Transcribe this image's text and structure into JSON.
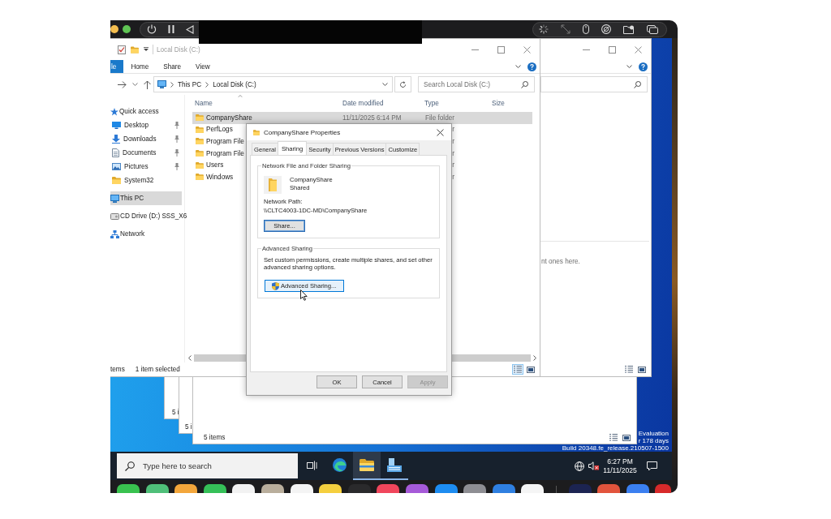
{
  "explorer": {
    "title": "Local Disk (C:)",
    "ribbon_tabs": [
      {
        "label": "le",
        "kind": "file"
      },
      {
        "label": "Home",
        "kind": "tab"
      },
      {
        "label": "Share",
        "kind": "tab"
      },
      {
        "label": "View",
        "kind": "tab"
      }
    ],
    "breadcrumbs": [
      "This PC",
      "Local Disk (C:)"
    ],
    "search": {
      "placeholder": "Search Local Disk (C:)"
    },
    "navigation": [
      {
        "label": "Quick access",
        "kind": "star",
        "selected": false,
        "children": [
          {
            "label": "Desktop",
            "kind": "desktop",
            "pinned": true,
            "selected": false
          },
          {
            "label": "Downloads",
            "kind": "downloads",
            "pinned": true,
            "selected": false
          },
          {
            "label": "Documents",
            "kind": "documents",
            "pinned": true,
            "selected": false
          },
          {
            "label": "Pictures",
            "kind": "pictures",
            "pinned": true,
            "selected": false
          },
          {
            "label": "System32",
            "kind": "folder",
            "pinned": false,
            "selected": false
          }
        ]
      },
      {
        "label": "This PC",
        "kind": "pc",
        "selected": true
      },
      {
        "label": "CD Drive (D:) SSS_X6",
        "kind": "cd",
        "selected": false
      },
      {
        "label": "Network",
        "kind": "network",
        "selected": false
      }
    ],
    "columns": [
      "Name",
      "Date modified",
      "Type",
      "Size"
    ],
    "rows": [
      {
        "name": "CompanyShare",
        "date_modified": "11/11/2025 6:14 PM",
        "type": "File folder",
        "selected": true
      },
      {
        "name": "PerfLogs",
        "type": "r",
        "selected": false
      },
      {
        "name": "Program File",
        "type": "r",
        "selected": false
      },
      {
        "name": "Program File",
        "type": "r",
        "selected": false
      },
      {
        "name": "Users",
        "type": "r",
        "selected": false
      },
      {
        "name": "Windows",
        "type": "r",
        "selected": false
      }
    ],
    "status_bar": {
      "item_count": "tems",
      "selection": "1 item selected"
    },
    "view_modes": [
      {
        "kind": "details",
        "selected": true
      },
      {
        "kind": "large-icons",
        "selected": false
      }
    ]
  },
  "properties_dialog": {
    "title": "CompanyShare Properties",
    "tabs": [
      {
        "label": "General",
        "selected": false
      },
      {
        "label": "Sharing",
        "selected": true
      },
      {
        "label": "Security",
        "selected": false
      },
      {
        "label": "Previous Versions",
        "selected": false
      },
      {
        "label": "Customize",
        "selected": false
      }
    ],
    "network_sharing": {
      "heading": "Network File and Folder Sharing",
      "folder_name": "CompanyShare",
      "share_status": "Shared",
      "path_label": "Network Path:",
      "path": "\\\\CLTC4003-1DC-MD\\CompanyShare",
      "button": {
        "label": "Share...",
        "focused": true
      }
    },
    "advanced_sharing": {
      "heading": "Advanced Sharing",
      "description": "Set custom permissions, create multiple shares, and set other advanced sharing options.",
      "button": {
        "label": "Advanced Sharing...",
        "hovered": true
      }
    },
    "buttons": [
      {
        "label": "OK",
        "disabled": false
      },
      {
        "label": "Cancel",
        "disabled": false
      },
      {
        "label": "Apply",
        "disabled": true
      }
    ]
  },
  "quick_access_window": {
    "message": "nt ones here.",
    "view_modes": [
      {
        "kind": "details",
        "selected": false
      },
      {
        "kind": "large-icons",
        "selected": false
      }
    ]
  },
  "background_windows": [
    {
      "status": "5 i"
    },
    {
      "status": "5 i"
    },
    {
      "status": "5 items",
      "view_modes": [
        {
          "kind": "details",
          "selected": false
        },
        {
          "kind": "large-icons",
          "selected": false
        }
      ]
    }
  ],
  "desktop_watermark": [
    "Evaluation",
    "r 178 days",
    "Build 20348.fe_release.210507-1500"
  ],
  "taskbar": {
    "search": {
      "placeholder": "Type here to search"
    },
    "apps": [
      {
        "kind": "task-view",
        "open": false,
        "active": false
      },
      {
        "kind": "browser",
        "open": false,
        "active": false
      },
      {
        "kind": "file-explorer",
        "open": true,
        "active": true
      },
      {
        "kind": "server-manager",
        "open": true,
        "active": false
      }
    ],
    "time": "6:27 PM",
    "date": "11/11/2025"
  }
}
